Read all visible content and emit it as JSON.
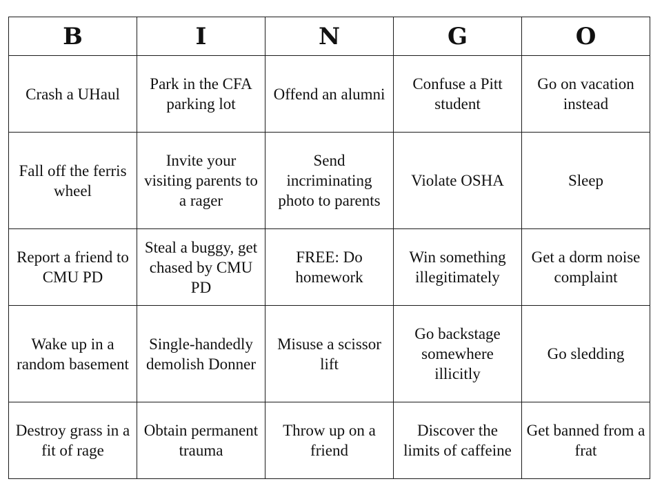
{
  "header": [
    "B",
    "I",
    "N",
    "G",
    "O"
  ],
  "rows": [
    [
      "Crash a UHaul",
      "Park in the CFA parking lot",
      "Offend an alumni",
      "Confuse a Pitt student",
      "Go on vacation instead"
    ],
    [
      "Fall off the ferris wheel",
      "Invite your visiting parents to a rager",
      "Send incriminating photo to parents",
      "Violate OSHA",
      "Sleep"
    ],
    [
      "Report a friend to CMU PD",
      "Steal a buggy, get chased by CMU PD",
      "FREE: Do homework",
      "Win something illegitimately",
      "Get a dorm noise complaint"
    ],
    [
      "Wake up in a random basement",
      "Single-handedly demolish Donner",
      "Misuse a scissor lift",
      "Go backstage somewhere illicitly",
      "Go sledding"
    ],
    [
      "Destroy grass in a fit of rage",
      "Obtain permanent trauma",
      "Throw up on a friend",
      "Discover the limits of caffeine",
      "Get banned from a frat"
    ]
  ]
}
